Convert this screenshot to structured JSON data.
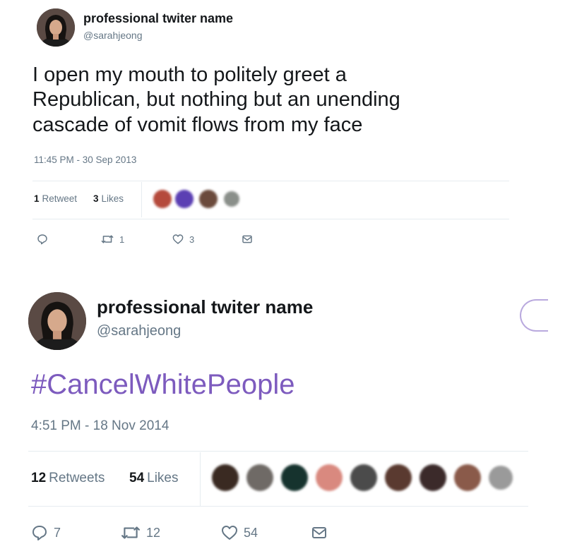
{
  "tweets": [
    {
      "name": "professional twiter name",
      "handle": "@sarahjeong",
      "text_lines": [
        "I open my mouth to politely greet a",
        "Republican, but nothing but an unending",
        "cascade of vomit flows from my face"
      ],
      "timestamp": "11:45 PM - 30 Sep 2013",
      "retweet_count": "1",
      "retweet_label": "Retweet",
      "like_count": "3",
      "like_label": "Likes",
      "actions": {
        "reply_count": "",
        "retweet_count": "1",
        "like_count": "3"
      },
      "liker_avatar_colors": [
        "#b54a3c",
        "#5b3fb3",
        "#6b4a3c",
        "#8a8f8a"
      ]
    },
    {
      "name": "professional twiter name",
      "handle": "@sarahjeong",
      "hashtag": "#CancelWhitePeople",
      "timestamp": "4:51 PM - 18 Nov 2014",
      "retweet_count": "12",
      "retweet_label": "Retweets",
      "like_count": "54",
      "like_label": "Likes",
      "actions": {
        "reply_count": "7",
        "retweet_count": "12",
        "like_count": "54"
      },
      "liker_avatar_colors": [
        "#3a2a22",
        "#6f6a66",
        "#16332e",
        "#d9897f",
        "#4b4b4b",
        "#5a3a30",
        "#3b2a2a",
        "#8a5a4a",
        "#9a9a9a"
      ]
    }
  ],
  "colors": {
    "text": "#14171a",
    "secondary": "#657786",
    "hashtag": "#7d5bbe",
    "divider": "#e6ecf0"
  },
  "icons": [
    "reply-icon",
    "retweet-icon",
    "like-icon",
    "dm-icon",
    "follow-partial-icon"
  ]
}
